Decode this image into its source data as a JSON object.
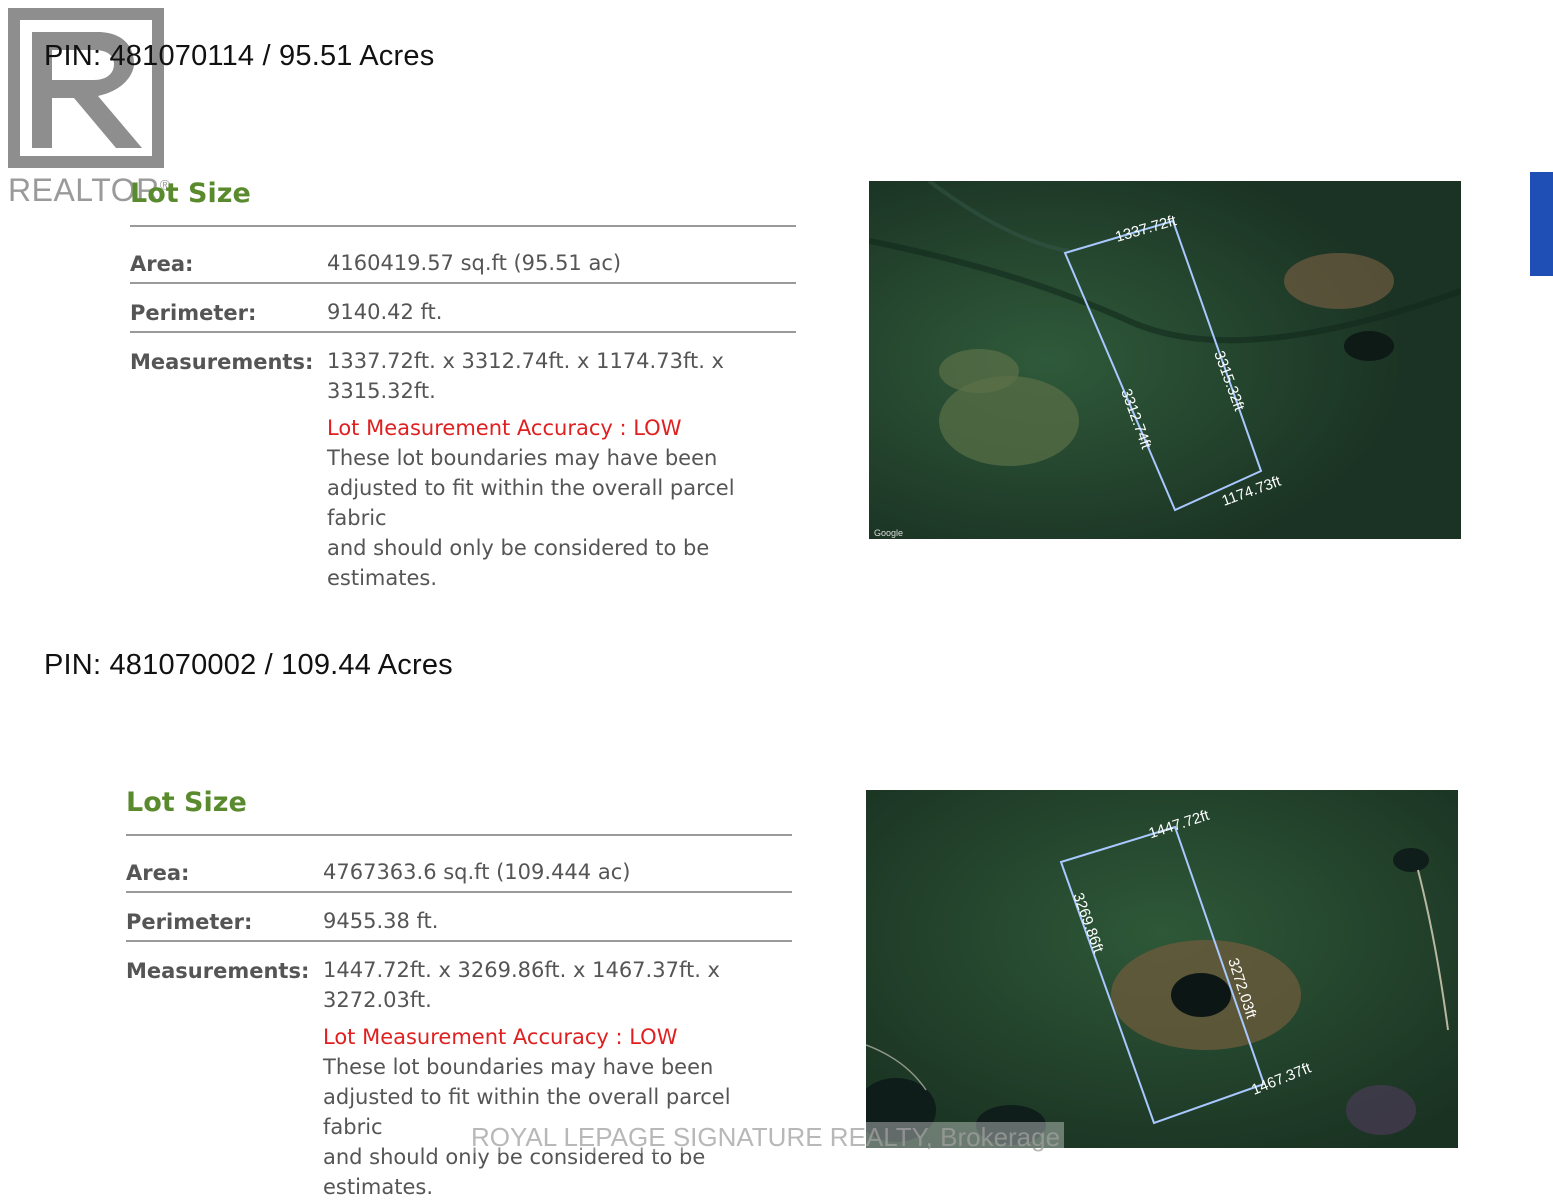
{
  "logo": {
    "text": "REALTOR",
    "registered": "®"
  },
  "watermark": "ROYAL LEPAGE SIGNATURE REALTY, Brokerage",
  "lots": [
    {
      "pin": "PIN: 481070114 / 95.51 Acres",
      "title": "Lot Size",
      "area_label": "Area:",
      "area_value": "4160419.57 sq.ft (95.51 ac)",
      "perimeter_label": "Perimeter:",
      "perimeter_value": "9140.42 ft.",
      "measurements_label": "Measurements:",
      "measurements_line1": "1337.72ft. x 3312.74ft. x 1174.73ft. x",
      "measurements_line2": "3315.32ft.",
      "accuracy": "Lot Measurement Accuracy : LOW",
      "note_lines": [
        "These lot boundaries may have been",
        "adjusted to fit within the overall parcel fabric",
        "and should only be considered to be",
        "estimates."
      ],
      "map_labels": [
        "1337.72ft",
        "3315.32ft",
        "3312.74ft",
        "1174.73ft"
      ],
      "map_credit": "Google"
    },
    {
      "pin": "PIN: 481070002 / 109.44 Acres",
      "title": "Lot Size",
      "area_label": "Area:",
      "area_value": "4767363.6 sq.ft (109.444 ac)",
      "perimeter_label": "Perimeter:",
      "perimeter_value": "9455.38 ft.",
      "measurements_label": "Measurements:",
      "measurements_line1": "1447.72ft. x 3269.86ft. x 1467.37ft. x",
      "measurements_line2": "3272.03ft.",
      "accuracy": "Lot Measurement Accuracy : LOW",
      "note_lines": [
        "These lot boundaries may have been",
        "adjusted to fit within the overall parcel fabric",
        "and should only be considered to be",
        "estimates."
      ],
      "map_labels": [
        "1447.72ft",
        "3269.86ft",
        "3272.03ft",
        "1467.37ft"
      ]
    }
  ],
  "colors": {
    "lot_title": "#5a8a2e",
    "accuracy": "#e02020",
    "boundary": "#a8c8ff",
    "map_forest": "#203a2a"
  }
}
